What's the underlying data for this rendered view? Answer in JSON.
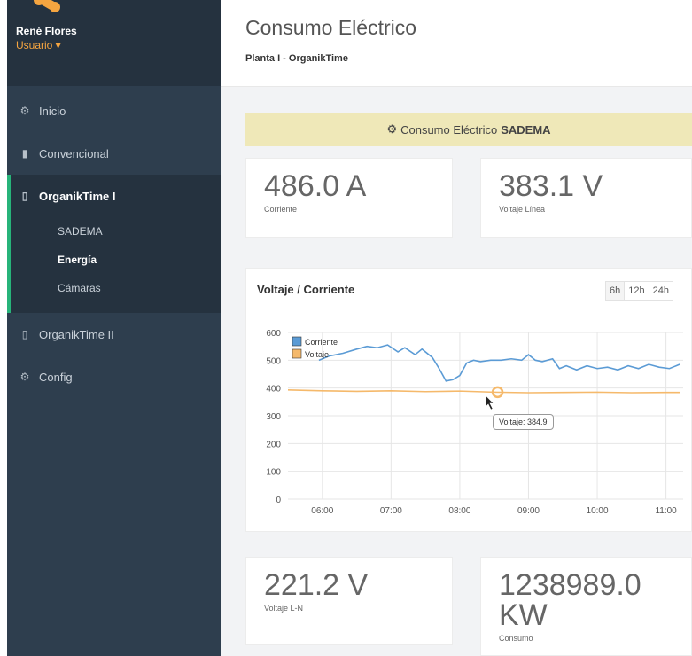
{
  "user": {
    "name": "René Flores",
    "role": "Usuario ▾"
  },
  "nav": {
    "inicio": "Inicio",
    "convencional": "Convencional",
    "organiktime1": "OrganikTime I",
    "sub": [
      "SADEMA",
      "Energía",
      "Cámaras"
    ],
    "organiktime2": "OrganikTime II",
    "config": "Config"
  },
  "header": {
    "title": "Consumo Eléctrico",
    "subtitle": "Planta I - OrganikTime"
  },
  "banner": {
    "prefix": "Consumo Eléctrico",
    "name": "SADEMA"
  },
  "metrics": [
    {
      "value": "486.0 A",
      "label": "Corriente"
    },
    {
      "value": "383.1 V",
      "label": "Voltaje Línea"
    },
    {
      "value": "221.2 V",
      "label": "Voltaje L-N"
    },
    {
      "value": "1238989.0 KW",
      "label": "Consumo"
    }
  ],
  "chart": {
    "title": "Voltaje / Corriente",
    "ranges": [
      "6h",
      "12h",
      "24h"
    ],
    "tooltip": "Voltaje: 384.9"
  },
  "colors": {
    "corriente": "#5b9bd5",
    "voltaje": "#f5b96b",
    "accent": "#27b47a",
    "banner": "#efe8b8"
  },
  "chart_data": {
    "type": "line",
    "ylim": [
      0,
      600
    ],
    "yticks": [
      0,
      100,
      200,
      300,
      400,
      500,
      600
    ],
    "xticks": [
      "06:00",
      "07:00",
      "08:00",
      "09:00",
      "10:00",
      "11:00"
    ],
    "xlim": [
      5.5,
      11.25
    ],
    "legend_position": "top-left",
    "series": [
      {
        "name": "Corriente",
        "color": "#5b9bd5",
        "x": [
          5.95,
          6.1,
          6.3,
          6.5,
          6.65,
          6.8,
          6.95,
          7.1,
          7.2,
          7.35,
          7.45,
          7.6,
          7.7,
          7.8,
          7.9,
          8.0,
          8.1,
          8.2,
          8.3,
          8.45,
          8.6,
          8.75,
          8.9,
          9.0,
          9.1,
          9.2,
          9.35,
          9.45,
          9.55,
          9.7,
          9.85,
          10.0,
          10.15,
          10.3,
          10.45,
          10.6,
          10.75,
          10.9,
          11.05,
          11.2
        ],
        "values": [
          500,
          515,
          525,
          540,
          550,
          545,
          555,
          530,
          545,
          520,
          540,
          510,
          470,
          425,
          430,
          445,
          490,
          500,
          495,
          500,
          500,
          505,
          500,
          520,
          500,
          495,
          505,
          470,
          480,
          465,
          480,
          470,
          475,
          465,
          480,
          470,
          485,
          475,
          470,
          485
        ]
      },
      {
        "name": "Voltaje",
        "color": "#f5b96b",
        "x": [
          5.5,
          6.0,
          6.5,
          7.0,
          7.5,
          8.0,
          8.5,
          9.0,
          9.5,
          10.0,
          10.5,
          11.0,
          11.2
        ],
        "values": [
          393,
          390,
          388,
          390,
          387,
          389,
          385,
          383,
          384,
          385,
          383,
          384,
          384
        ]
      }
    ]
  }
}
